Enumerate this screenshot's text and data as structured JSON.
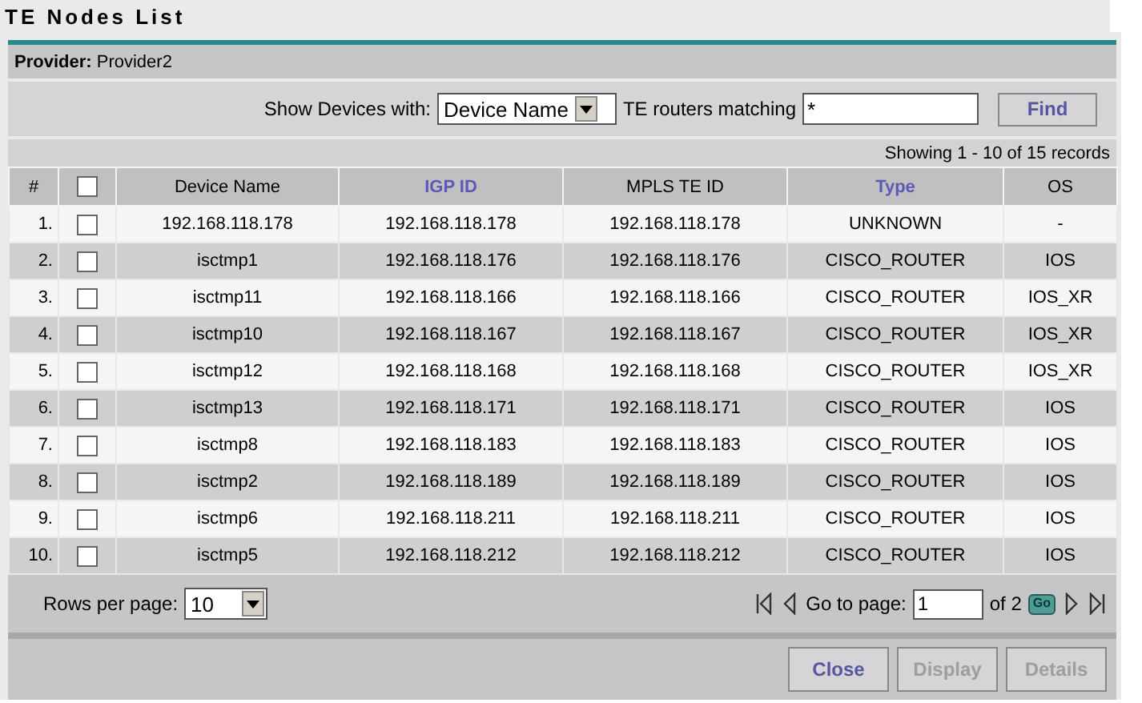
{
  "title": "TE Nodes List",
  "provider": {
    "label": "Provider:",
    "value": "Provider2"
  },
  "filter": {
    "label": "Show Devices with:",
    "select": "Device Name",
    "match_label": "TE routers matching",
    "match_value": "*",
    "find": "Find"
  },
  "summary": "Showing 1 - 10 of 15 records",
  "table": {
    "select_all_checked": false,
    "columns": [
      {
        "label": "#",
        "kind": "number",
        "sortable": false
      },
      {
        "kind": "checkbox"
      },
      {
        "label": "Device Name",
        "sortable": false
      },
      {
        "label": "IGP ID",
        "sortable": true
      },
      {
        "label": "MPLS TE ID",
        "sortable": false
      },
      {
        "label": "Type",
        "sortable": true
      },
      {
        "label": "OS",
        "sortable": false
      }
    ],
    "rows": [
      {
        "checked": false,
        "cells": [
          "1.",
          "",
          "192.168.118.178",
          "192.168.118.178",
          "192.168.118.178",
          "UNKNOWN",
          "-"
        ]
      },
      {
        "checked": false,
        "cells": [
          "2.",
          "",
          "isctmp1",
          "192.168.118.176",
          "192.168.118.176",
          "CISCO_ROUTER",
          "IOS"
        ]
      },
      {
        "checked": false,
        "cells": [
          "3.",
          "",
          "isctmp11",
          "192.168.118.166",
          "192.168.118.166",
          "CISCO_ROUTER",
          "IOS_XR"
        ]
      },
      {
        "checked": false,
        "cells": [
          "4.",
          "",
          "isctmp10",
          "192.168.118.167",
          "192.168.118.167",
          "CISCO_ROUTER",
          "IOS_XR"
        ]
      },
      {
        "checked": false,
        "cells": [
          "5.",
          "",
          "isctmp12",
          "192.168.118.168",
          "192.168.118.168",
          "CISCO_ROUTER",
          "IOS_XR"
        ]
      },
      {
        "checked": false,
        "cells": [
          "6.",
          "",
          "isctmp13",
          "192.168.118.171",
          "192.168.118.171",
          "CISCO_ROUTER",
          "IOS"
        ]
      },
      {
        "checked": false,
        "cells": [
          "7.",
          "",
          "isctmp8",
          "192.168.118.183",
          "192.168.118.183",
          "CISCO_ROUTER",
          "IOS"
        ]
      },
      {
        "checked": false,
        "cells": [
          "8.",
          "",
          "isctmp2",
          "192.168.118.189",
          "192.168.118.189",
          "CISCO_ROUTER",
          "IOS"
        ]
      },
      {
        "checked": false,
        "cells": [
          "9.",
          "",
          "isctmp6",
          "192.168.118.211",
          "192.168.118.211",
          "CISCO_ROUTER",
          "IOS"
        ]
      },
      {
        "checked": false,
        "cells": [
          "10.",
          "",
          "isctmp5",
          "192.168.118.212",
          "192.168.118.212",
          "CISCO_ROUTER",
          "IOS"
        ]
      }
    ]
  },
  "pager": {
    "rows_label": "Rows per page:",
    "rows_value": "10",
    "goto_label": "Go to page:",
    "page_value": "1",
    "of_label": "of 2",
    "go": "Go"
  },
  "buttons": [
    {
      "label": "Close",
      "disabled": false
    },
    {
      "label": "Display",
      "disabled": true
    },
    {
      "label": "Details",
      "disabled": true
    }
  ]
}
